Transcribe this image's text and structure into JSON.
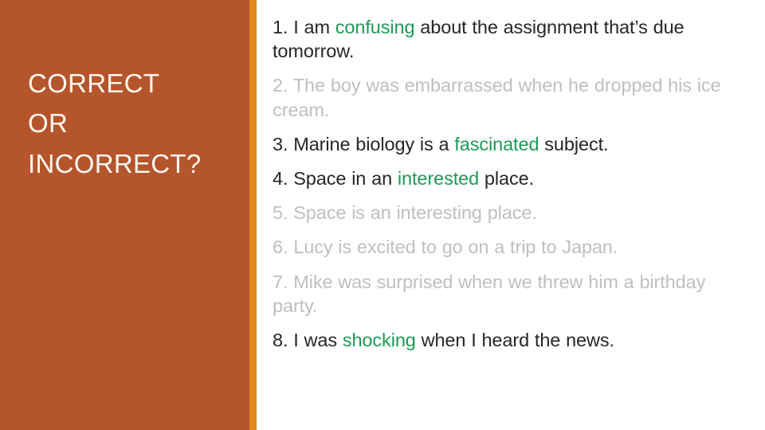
{
  "slide": {
    "title": "CORRECT\nOR\nINCORRECT?",
    "title_lines": [
      "CORRECT",
      "OR",
      "INCORRECT?"
    ]
  },
  "colors": {
    "sidebar_background": "#B5552B",
    "accent_stripe": "#E08A1E",
    "title_text": "#FDF7F2",
    "body_text_dark": "#262626",
    "body_text_faded": "#BFBFBF",
    "highlight_green": "#1E9A55",
    "page_background": "#FFFFFF"
  },
  "items": [
    {
      "number": "1.",
      "state": "dark",
      "pre": "1. I am ",
      "highlight": "confusing",
      "post": " about the assignment that’s due tomorrow.",
      "full_text": "1. I am confusing about the assignment that’s due tomorrow."
    },
    {
      "number": "2.",
      "state": "faded",
      "pre": "2. The boy was embarrassed when he dropped his ice cream.",
      "highlight": "",
      "post": "",
      "full_text": "2. The boy was embarrassed when he dropped his ice cream."
    },
    {
      "number": "3.",
      "state": "dark",
      "pre": "3. Marine biology is a ",
      "highlight": "fascinated",
      "post": " subject.",
      "full_text": "3. Marine biology is a fascinated subject."
    },
    {
      "number": "4.",
      "state": "dark",
      "pre": "4. Space in an ",
      "highlight": "interested",
      "post": " place.",
      "full_text": "4. Space in an interested place."
    },
    {
      "number": "5.",
      "state": "faded",
      "pre": "5. Space is an interesting place.",
      "highlight": "",
      "post": "",
      "full_text": "5. Space is an interesting place."
    },
    {
      "number": "6.",
      "state": "faded",
      "pre": "6. Lucy is excited to go on a trip to Japan.",
      "highlight": "",
      "post": "",
      "full_text": "6. Lucy is excited to go on a trip to Japan."
    },
    {
      "number": "7.",
      "state": "faded",
      "pre": "7. Mike was surprised when we threw him a birthday party.",
      "highlight": "",
      "post": "",
      "full_text": "7. Mike was surprised when we threw him a birthday party."
    },
    {
      "number": "8.",
      "state": "dark",
      "pre": "8. I was ",
      "highlight": "shocking",
      "post": " when I heard the news.",
      "full_text": "8. I was shocking when I heard the news."
    }
  ]
}
